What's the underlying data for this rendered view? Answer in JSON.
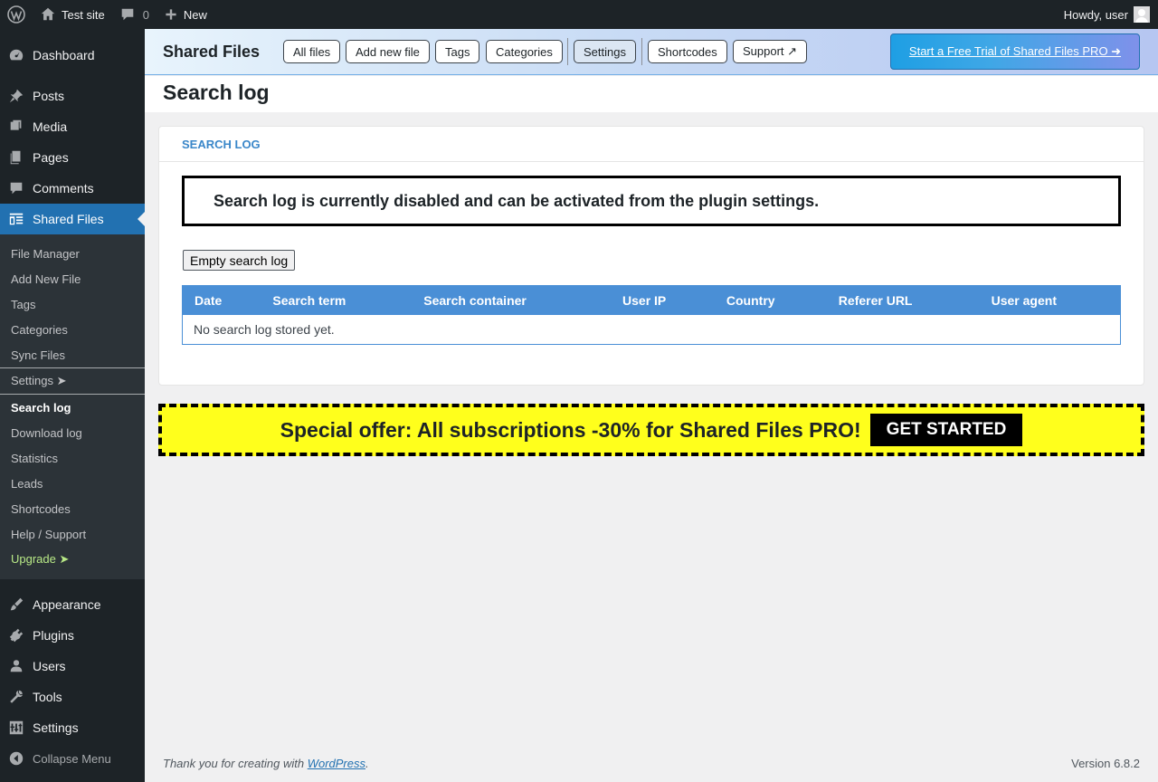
{
  "adminbar": {
    "site_name": "Test site",
    "comments_count": "0",
    "new_label": "New",
    "howdy": "Howdy, user"
  },
  "sidebar": {
    "items": [
      {
        "label": "Dashboard",
        "icon": "dashboard-icon"
      },
      {
        "label": "Posts",
        "icon": "pin-icon"
      },
      {
        "label": "Media",
        "icon": "media-icon"
      },
      {
        "label": "Pages",
        "icon": "pages-icon"
      },
      {
        "label": "Comments",
        "icon": "comment-icon"
      },
      {
        "label": "Shared Files",
        "icon": "shared-files-icon"
      }
    ],
    "submenu": [
      "File Manager",
      "Add New File",
      "Tags",
      "Categories",
      "Sync Files",
      "Settings ➤",
      "Search log",
      "Download log",
      "Statistics",
      "Leads",
      "Shortcodes",
      "Help / Support",
      "Upgrade ➤"
    ],
    "lower_items": [
      {
        "label": "Appearance",
        "icon": "brush-icon"
      },
      {
        "label": "Plugins",
        "icon": "plugin-icon"
      },
      {
        "label": "Users",
        "icon": "users-icon"
      },
      {
        "label": "Tools",
        "icon": "wrench-icon"
      },
      {
        "label": "Settings",
        "icon": "settings-icon"
      }
    ],
    "collapse": "Collapse Menu"
  },
  "plugin_header": {
    "title": "Shared Files",
    "buttons": [
      "All files",
      "Add new file",
      "Tags",
      "Categories",
      "Settings",
      "Shortcodes",
      "Support ↗"
    ],
    "trial": "Start a Free Trial of Shared Files PRO ➜"
  },
  "page": {
    "title": "Search log",
    "card_title": "SEARCH LOG",
    "notice": "Search log is currently disabled and can be activated from the plugin settings.",
    "empty_button": "Empty search log"
  },
  "table": {
    "columns": [
      "Date",
      "Search term",
      "Search container",
      "User IP",
      "Country",
      "Referer URL",
      "User agent"
    ],
    "empty_message": "No search log stored yet."
  },
  "offer": {
    "text": "Special offer: All subscriptions -30% for Shared Files PRO!",
    "button": "GET STARTED"
  },
  "footer": {
    "thanks_prefix": "Thank you for creating with ",
    "wp_link": "WordPress",
    "thanks_suffix": ".",
    "version": "Version 6.8.2"
  }
}
